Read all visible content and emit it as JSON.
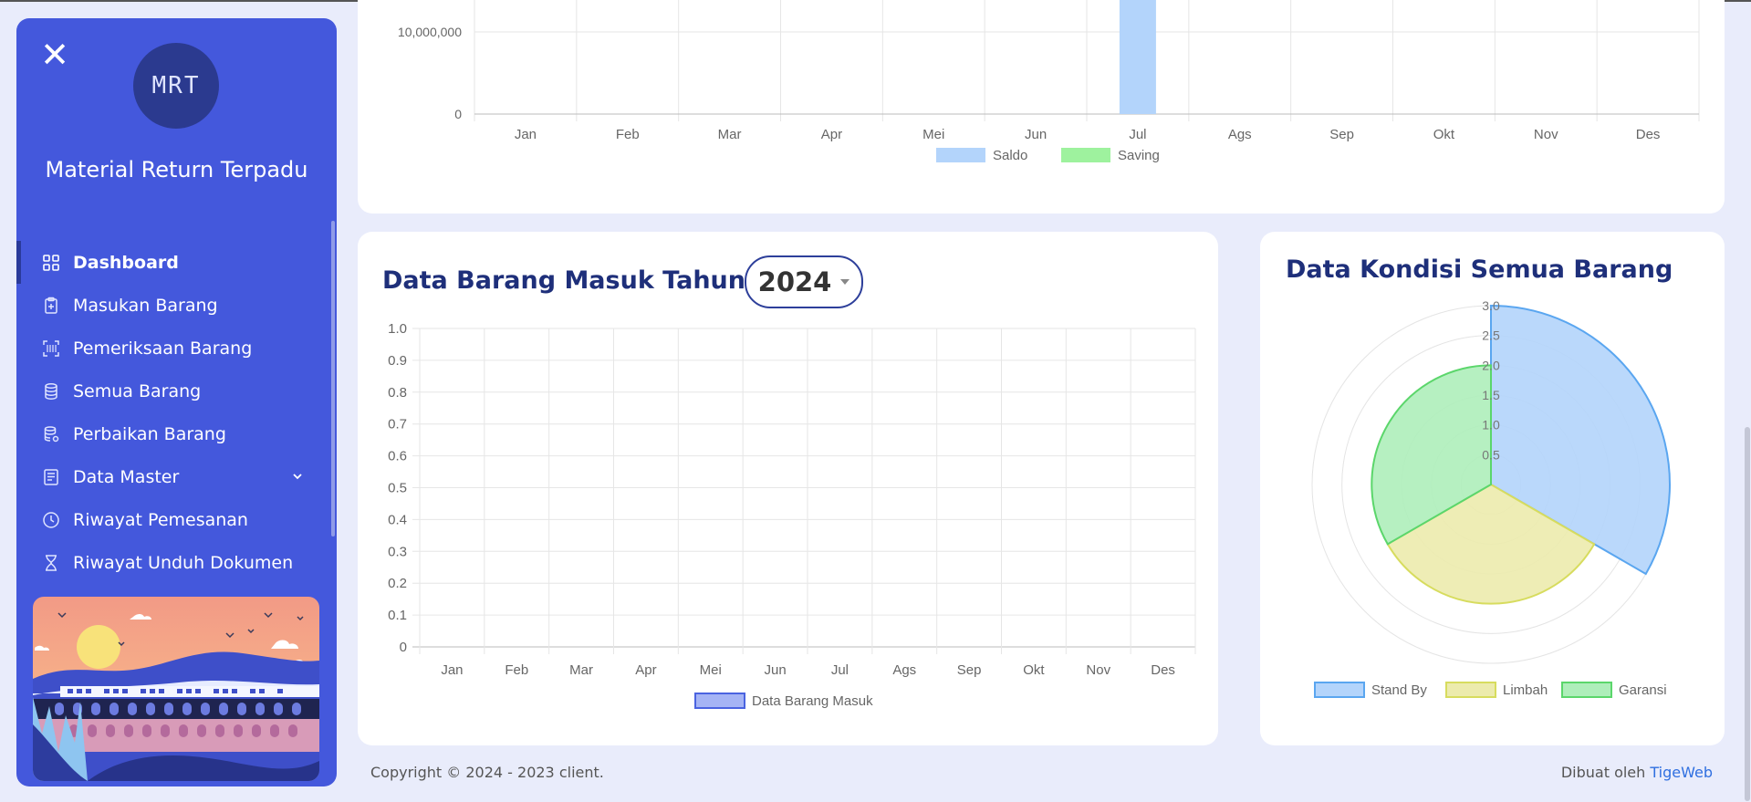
{
  "sidebar": {
    "logo_text": "MRT",
    "app_title": "Material Return Terpadu",
    "items": [
      {
        "label": "Dashboard",
        "icon": "grid-icon",
        "active": true
      },
      {
        "label": "Masukan Barang",
        "icon": "clipboard-add-icon"
      },
      {
        "label": "Pemeriksaan Barang",
        "icon": "scan-icon"
      },
      {
        "label": "Semua Barang",
        "icon": "database-icon"
      },
      {
        "label": "Perbaikan Barang",
        "icon": "database-repair-icon"
      },
      {
        "label": "Data Master",
        "icon": "document-list-icon",
        "has_submenu": true
      },
      {
        "label": "Riwayat Pemesanan",
        "icon": "clock-icon"
      },
      {
        "label": "Riwayat Unduh Dokumen",
        "icon": "hourglass-icon"
      }
    ],
    "accent_color": "#4458dc"
  },
  "top_chart": {
    "chart_data": {
      "type": "bar",
      "categories": [
        "Jan",
        "Feb",
        "Mar",
        "Apr",
        "Mei",
        "Jun",
        "Jul",
        "Ags",
        "Sep",
        "Okt",
        "Nov",
        "Des"
      ],
      "y_ticks": [
        "10,000,000",
        "0"
      ],
      "series": [
        {
          "name": "Saldo",
          "color": "#b3d4fb",
          "values": [
            0,
            0,
            0,
            0,
            0,
            0,
            14000000,
            0,
            0,
            0,
            0,
            0
          ]
        },
        {
          "name": "Saving",
          "color": "#9ef29e",
          "values": [
            0,
            0,
            0,
            0,
            0,
            0,
            0,
            0,
            0,
            0,
            0,
            0
          ]
        }
      ],
      "legend_position": "bottom",
      "grid": true
    }
  },
  "incoming_chart": {
    "title": "Data Barang Masuk Tahun",
    "year_selected": "2024",
    "chart_data": {
      "type": "bar",
      "categories": [
        "Jan",
        "Feb",
        "Mar",
        "Apr",
        "Mei",
        "Jun",
        "Jul",
        "Ags",
        "Sep",
        "Okt",
        "Nov",
        "Des"
      ],
      "y_ticks": [
        "0",
        "0.1",
        "0.2",
        "0.3",
        "0.4",
        "0.5",
        "0.6",
        "0.7",
        "0.8",
        "0.9",
        "1.0"
      ],
      "ylim": [
        0,
        1
      ],
      "series": [
        {
          "name": "Data Barang Masuk",
          "color": "#a5b4f5",
          "values": [
            0,
            0,
            0,
            0,
            0,
            0,
            0,
            0,
            0,
            0,
            0,
            0
          ]
        }
      ],
      "legend_position": "bottom",
      "grid": true
    }
  },
  "condition_chart": {
    "title": "Data Kondisi Semua Barang",
    "chart_data": {
      "type": "polarArea",
      "categories": [
        "Stand By",
        "Limbah",
        "Garansi"
      ],
      "values": [
        3,
        2,
        2
      ],
      "colors": [
        "#b3d4fb",
        "#ecebad",
        "#aeeeba"
      ],
      "border_colors": [
        "#5aa6f0",
        "#d7dc5e",
        "#5bd66b"
      ],
      "r_ticks": [
        "0.5",
        "1.0",
        "1.5",
        "2.0",
        "2.5",
        "3.0"
      ],
      "rlim": [
        0,
        3
      ],
      "legend_position": "bottom"
    }
  },
  "footer": {
    "copyright": "Copyright © 2024 - 2023 client.",
    "made_by_prefix": "Dibuat oleh",
    "made_by_link": "TigeWeb"
  }
}
